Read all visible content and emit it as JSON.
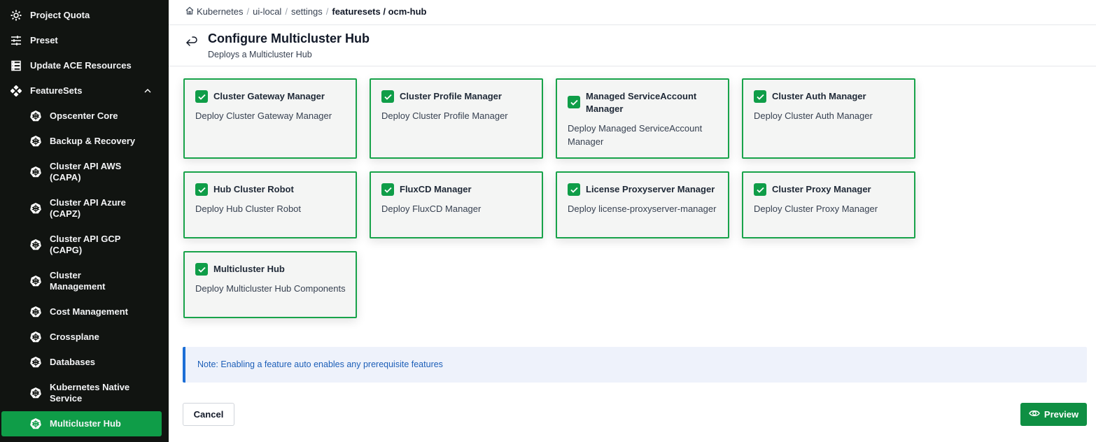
{
  "sidebar": {
    "top_items": [
      {
        "label": "Project Quota",
        "icon": "gear-icon"
      },
      {
        "label": "Preset",
        "icon": "sliders-icon"
      },
      {
        "label": "Update ACE Resources",
        "icon": "server-icon"
      },
      {
        "label": "FeatureSets",
        "icon": "featuresets-icon"
      }
    ],
    "sub_items": [
      {
        "label": "Opscenter Core"
      },
      {
        "label": "Backup & Recovery"
      },
      {
        "label": "Cluster API AWS (CAPA)"
      },
      {
        "label": "Cluster API Azure (CAPZ)"
      },
      {
        "label": "Cluster API GCP (CAPG)"
      },
      {
        "label": "Cluster Management"
      },
      {
        "label": "Cost Management"
      },
      {
        "label": "Crossplane"
      },
      {
        "label": "Databases"
      },
      {
        "label": "Kubernetes Native Service"
      },
      {
        "label": "Multicluster Hub"
      }
    ],
    "active_item": "Multicluster Hub"
  },
  "breadcrumb": {
    "items": [
      "Kubernetes",
      "ui-local",
      "settings"
    ],
    "current": "featuresets / ocm-hub"
  },
  "header": {
    "title": "Configure Multicluster Hub",
    "subtitle": "Deploys a Multicluster Hub"
  },
  "features": [
    {
      "title": "Cluster Gateway Manager",
      "description": "Deploy Cluster Gateway Manager",
      "checked": true
    },
    {
      "title": "Cluster Profile Manager",
      "description": "Deploy Cluster Profile Manager",
      "checked": true
    },
    {
      "title": "Managed ServiceAccount Manager",
      "description": "Deploy Managed ServiceAccount Manager",
      "checked": true
    },
    {
      "title": "Cluster Auth Manager",
      "description": "Deploy Cluster Auth Manager",
      "checked": true
    },
    {
      "title": "Hub Cluster Robot",
      "description": "Deploy Hub Cluster Robot",
      "checked": true
    },
    {
      "title": "FluxCD Manager",
      "description": "Deploy FluxCD Manager",
      "checked": true
    },
    {
      "title": "License Proxyserver Manager",
      "description": "Deploy license-proxyserver-manager",
      "checked": true
    },
    {
      "title": "Cluster Proxy Manager",
      "description": "Deploy Cluster Proxy Manager",
      "checked": true
    },
    {
      "title": "Multicluster Hub",
      "description": "Deploy Multicluster Hub Components",
      "checked": true
    }
  ],
  "note": "Note: Enabling a feature auto enables any prerequisite features",
  "actions": {
    "cancel_label": "Cancel",
    "preview_label": "Preview"
  },
  "colors": {
    "sidebar_bg": "#111411",
    "accent_green": "#0f9d48",
    "note_bg": "#eef2fb",
    "note_border": "#1d6fd6"
  }
}
